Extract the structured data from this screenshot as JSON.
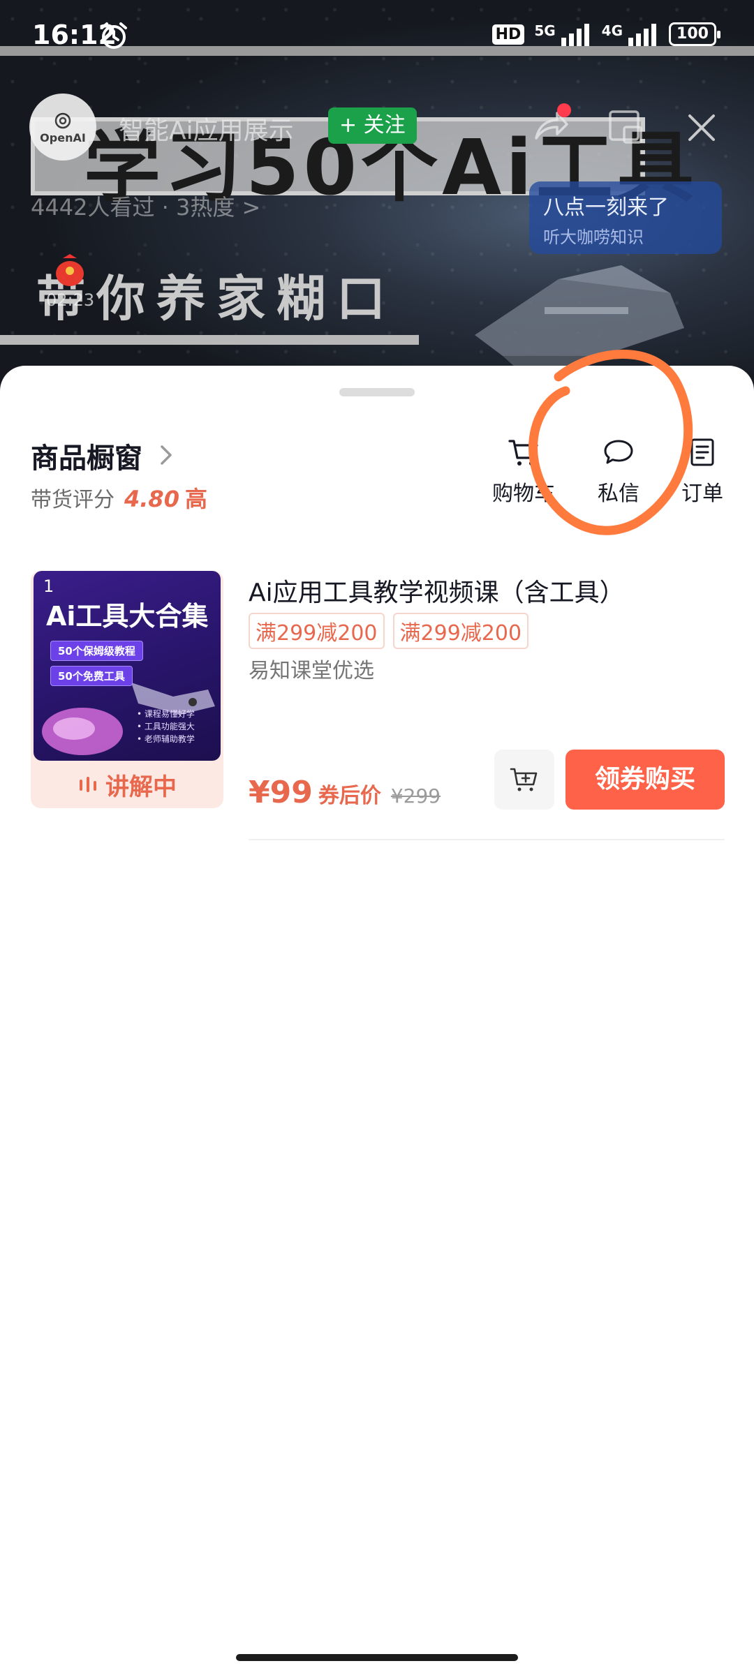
{
  "status_bar": {
    "time": "16:12",
    "hd_badge": "HD",
    "network_1": "5G",
    "network_2": "4G",
    "battery": "100"
  },
  "live_header": {
    "avatar_text": "OpenAI",
    "channel_name": "智能Ai应用展示",
    "follow_label": "+ 关注",
    "viewers": "4442人看过 · 3热度 >",
    "redbag_timer": "02:23",
    "promo_main": "八点一刻来了",
    "promo_sub": "听大咖唠知识"
  },
  "banner": {
    "title": "学习50个Ai工具",
    "subtitle": "带你养家糊口"
  },
  "sheet": {
    "shop_title": "商品橱窗",
    "rating_label": "带货评分",
    "rating_value": "4.80",
    "rating_grade": "高",
    "actions": [
      {
        "label": "购物车",
        "icon": "cart-icon"
      },
      {
        "label": "私信",
        "icon": "chat-bubble-icon"
      },
      {
        "label": "订单",
        "icon": "order-list-icon"
      }
    ]
  },
  "product": {
    "index": "1",
    "thumb_headline": "Ai工具大合集",
    "thumb_tag_1": "50个保姆级教程",
    "thumb_tag_2": "50个免费工具",
    "thumb_bullets": [
      "• 课程易懂好学",
      "• 工具功能强大",
      "• 老师辅助教学"
    ],
    "live_status": "讲解中",
    "title": "Ai应用工具教学视频课（含工具）",
    "coupons": [
      "满299减200",
      "满299减200"
    ],
    "source": "易知课堂优选",
    "price": "¥99",
    "price_after_label": "券后价",
    "original_price": "¥299",
    "buy_label": "领券购买"
  },
  "colors": {
    "accent": "#fe6249",
    "price_red": "#e8684e",
    "follow_green": "#1aa14a",
    "annotation_orange": "#ff7a3d"
  }
}
